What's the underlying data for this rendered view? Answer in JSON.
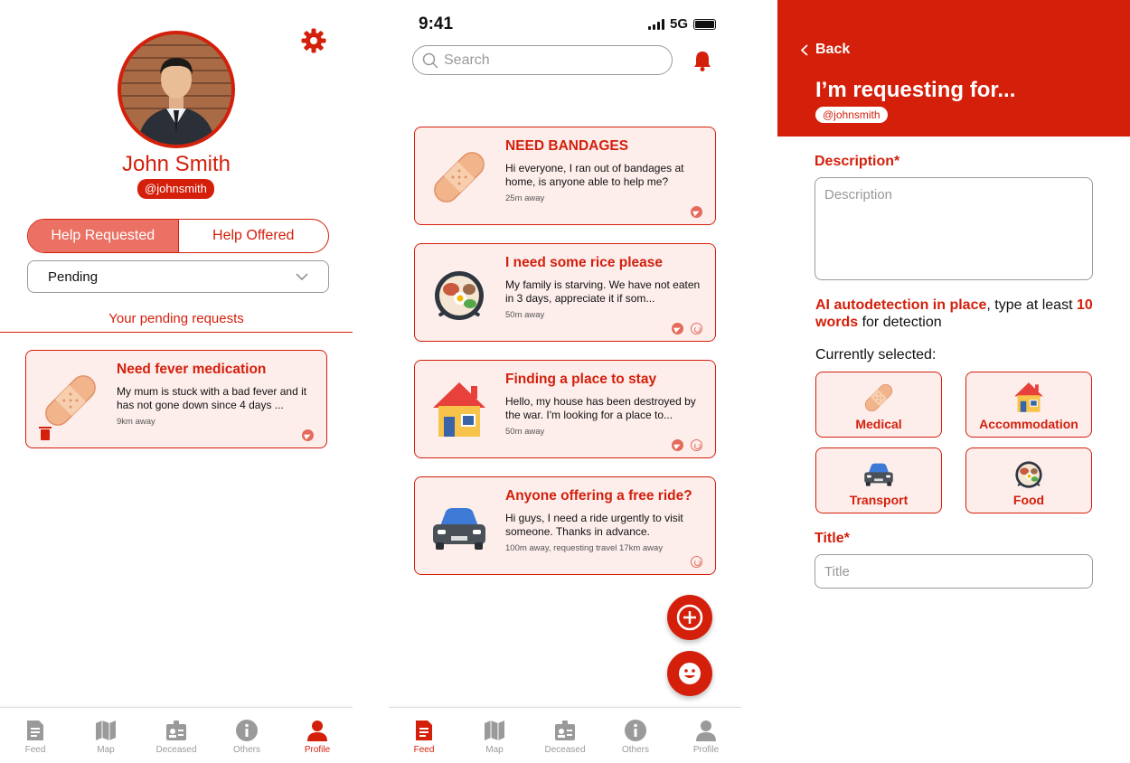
{
  "profile": {
    "name": "John Smith",
    "handle": "@johnsmith",
    "tabs": {
      "requested": "Help Requested",
      "offered": "Help Offered"
    },
    "filter_value": "Pending",
    "section_title": "Your pending requests",
    "request": {
      "title": "Need fever medication",
      "desc": "My mum is stuck with a bad fever and it has not gone down since 4 days ...",
      "distance": "9km away"
    }
  },
  "feed": {
    "status_time": "9:41",
    "network": "5G",
    "search_placeholder": "Search",
    "posts": [
      {
        "title": "NEED BANDAGES",
        "desc": "Hi everyone, I ran out of bandages at home, is anyone able to help me?",
        "distance": "25m away",
        "icon": "bandage-icon"
      },
      {
        "title": "I need some rice please",
        "desc": "My family is starving. We have not eaten in 3 days, appreciate it if som...",
        "distance": "50m away",
        "icon": "food-icon"
      },
      {
        "title": "Finding a place to stay",
        "desc": "Hello, my house has been destroyed by the war. I'm looking for a place to...",
        "distance": "50m away",
        "icon": "house-icon"
      },
      {
        "title": "Anyone offering a free ride?",
        "desc": "Hi guys, I need a ride urgently to visit someone. Thanks in advance.",
        "distance": "100m away, requesting travel 17km away",
        "icon": "car-icon"
      }
    ]
  },
  "nav": {
    "feed": "Feed",
    "map": "Map",
    "deceased": "Deceased",
    "others": "Others",
    "profile": "Profile"
  },
  "form": {
    "back": "Back",
    "heading": "I’m requesting for...",
    "handle": "@johnsmith",
    "description_label": "Description*",
    "description_placeholder": "Description",
    "note_bold1": "AI autodetection in place",
    "note_text1": ", type at least ",
    "note_bold2": "10 words",
    "note_text2": " for detection",
    "currently_selected": "Currently selected:",
    "categories": [
      "Medical",
      "Accommodation",
      "Transport",
      "Food"
    ],
    "title_label": "Title*",
    "title_placeholder": "Title"
  },
  "colors": {
    "accent": "#d41f0b",
    "card_bg": "#fdeeec",
    "active_tab": "#ea7163"
  }
}
